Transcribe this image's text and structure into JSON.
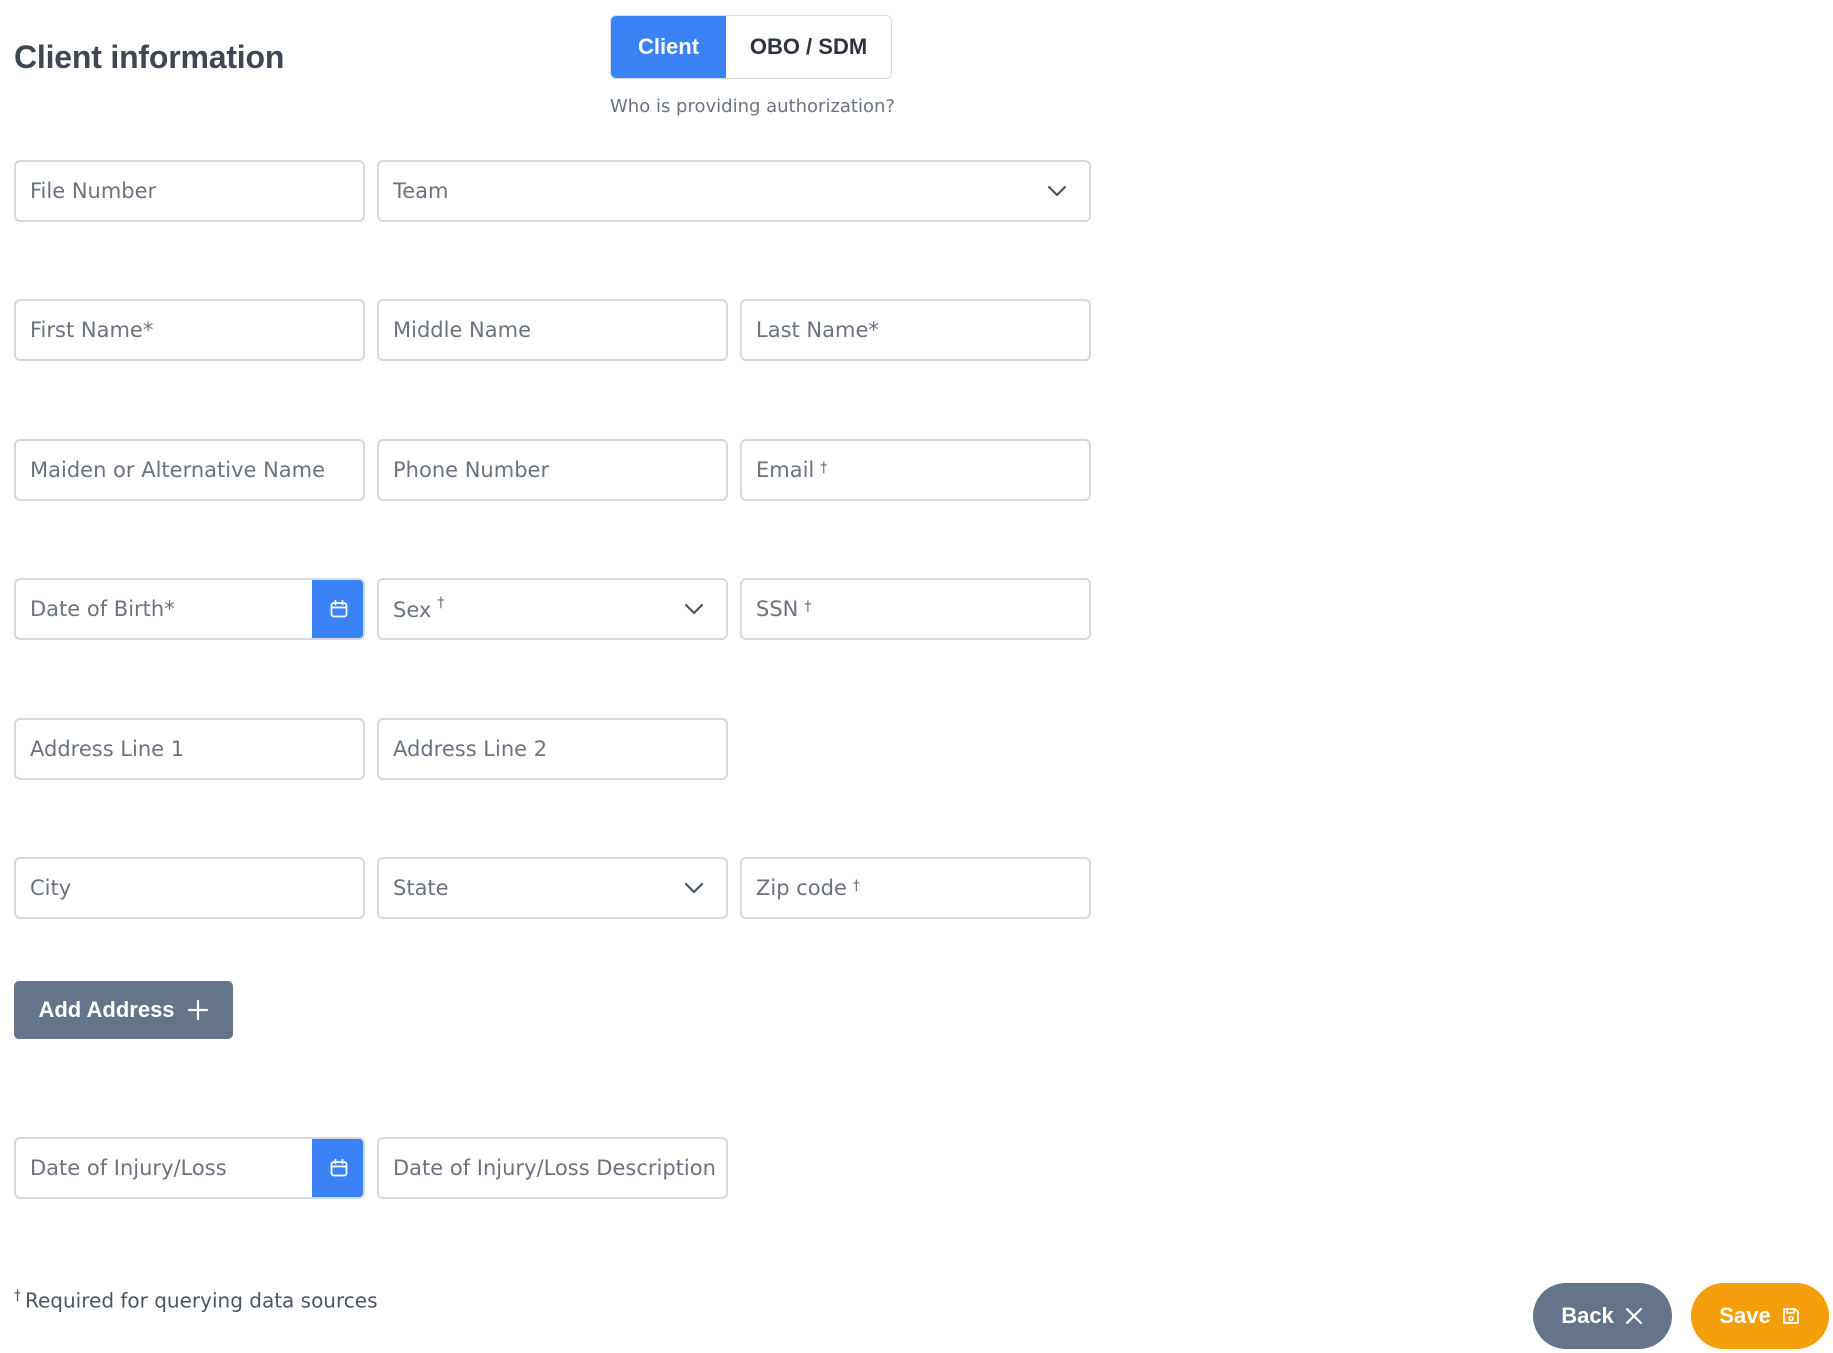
{
  "page": {
    "title": "Client information"
  },
  "authorization": {
    "options": [
      "Client",
      "OBO / SDM"
    ],
    "selected": "Client",
    "caption": "Who is providing authorization?"
  },
  "fields": {
    "file_number": {
      "placeholder": "File Number",
      "value": ""
    },
    "team": {
      "placeholder": "Team",
      "value": ""
    },
    "first_name": {
      "placeholder": "First Name*",
      "value": ""
    },
    "middle_name": {
      "placeholder": "Middle Name",
      "value": ""
    },
    "last_name": {
      "placeholder": "Last Name*",
      "value": ""
    },
    "maiden_name": {
      "placeholder": "Maiden or Alternative Name",
      "value": ""
    },
    "phone_number": {
      "placeholder": "Phone Number",
      "value": ""
    },
    "email": {
      "placeholder": "Email",
      "marker": "†",
      "value": ""
    },
    "date_of_birth": {
      "placeholder": "Date of Birth*",
      "value": ""
    },
    "sex": {
      "placeholder": "Sex",
      "marker": "†",
      "value": ""
    },
    "ssn": {
      "placeholder": "SSN",
      "marker": "†",
      "value": ""
    },
    "address_line_1": {
      "placeholder": "Address Line 1",
      "value": ""
    },
    "address_line_2": {
      "placeholder": "Address Line 2",
      "value": ""
    },
    "city": {
      "placeholder": "City",
      "value": ""
    },
    "state": {
      "placeholder": "State",
      "value": ""
    },
    "zip_code": {
      "placeholder": "Zip code",
      "marker": "†",
      "value": ""
    },
    "date_of_injury": {
      "placeholder": "Date of Injury/Loss",
      "value": ""
    },
    "date_of_injury_description": {
      "placeholder": "Date of Injury/Loss Description",
      "value": ""
    }
  },
  "buttons": {
    "add_address": "Add Address",
    "back": "Back",
    "save": "Save"
  },
  "footnote": {
    "marker": "†",
    "text": "Required for querying data sources"
  },
  "icons": {
    "dropdown": "chevron-down-icon",
    "date_picker": "calendar-icon",
    "add": "plus-icon",
    "back": "close-icon",
    "save": "floppy-disk-icon"
  },
  "colors": {
    "primary": "#3b82f6",
    "secondary": "#64748b",
    "accent": "#f59e0b",
    "border": "#d4d8df"
  }
}
